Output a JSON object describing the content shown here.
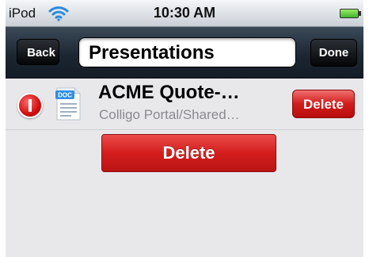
{
  "status_bar": {
    "carrier": "iPod",
    "time": "10:30 AM",
    "wifi_icon": "wifi-icon",
    "battery_icon": "battery-icon"
  },
  "nav_bar": {
    "back_label": "Back",
    "title": "Presentations",
    "done_label": "Done"
  },
  "row": {
    "name": "ACME Quote-…",
    "path": "Colligo Portal/Shared…",
    "file_badge": "DOC",
    "delete_label": "Delete"
  },
  "actions": {
    "delete_label": "Delete"
  },
  "colors": {
    "delete_red": "#d41d1d",
    "nav_dark": "#1c2733",
    "background": "#e8e8eb"
  }
}
